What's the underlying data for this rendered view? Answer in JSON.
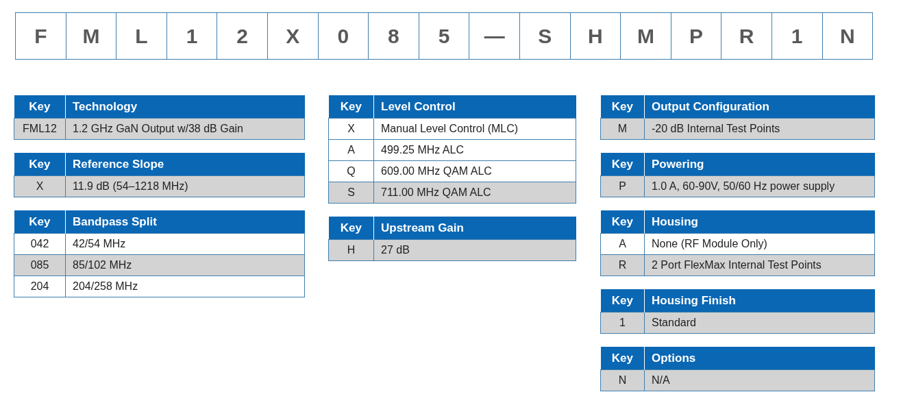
{
  "part_number": [
    "F",
    "M",
    "L",
    "1",
    "2",
    "X",
    "0",
    "8",
    "5",
    "—",
    "S",
    "H",
    "M",
    "P",
    "R",
    "1",
    "N"
  ],
  "columns": [
    [
      {
        "key_heading": "Key",
        "heading": "Technology",
        "rows": [
          {
            "key": "FML12",
            "description": "1.2 GHz GaN Output w/38 dB Gain",
            "selected": true
          }
        ]
      },
      {
        "key_heading": "Key",
        "heading": "Reference Slope",
        "rows": [
          {
            "key": "X",
            "description": "11.9 dB (54–1218 MHz)",
            "selected": true
          }
        ]
      },
      {
        "key_heading": "Key",
        "heading": "Bandpass Split",
        "rows": [
          {
            "key": "042",
            "description": "42/54 MHz",
            "selected": false
          },
          {
            "key": "085",
            "description": "85/102 MHz",
            "selected": true
          },
          {
            "key": "204",
            "description": "204/258 MHz",
            "selected": false
          }
        ]
      }
    ],
    [
      {
        "key_heading": "Key",
        "heading": "Level Control",
        "rows": [
          {
            "key": "X",
            "description": "Manual Level Control (MLC)",
            "selected": false
          },
          {
            "key": "A",
            "description": "499.25 MHz ALC",
            "selected": false
          },
          {
            "key": "Q",
            "description": "609.00 MHz QAM ALC",
            "selected": false
          },
          {
            "key": "S",
            "description": "711.00 MHz QAM ALC",
            "selected": true
          }
        ]
      },
      {
        "key_heading": "Key",
        "heading": "Upstream Gain",
        "rows": [
          {
            "key": "H",
            "description": "27 dB",
            "selected": true
          }
        ]
      }
    ],
    [
      {
        "key_heading": "Key",
        "heading": "Output Configuration",
        "rows": [
          {
            "key": "M",
            "description": "-20 dB Internal Test Points",
            "selected": true
          }
        ]
      },
      {
        "key_heading": "Key",
        "heading": "Powering",
        "rows": [
          {
            "key": "P",
            "description": "1.0 A, 60-90V, 50/60 Hz power supply",
            "selected": true
          }
        ]
      },
      {
        "key_heading": "Key",
        "heading": "Housing",
        "rows": [
          {
            "key": "A",
            "description": "None (RF Module Only)",
            "selected": false
          },
          {
            "key": "R",
            "description": "2 Port FlexMax Internal Test Points",
            "selected": true
          }
        ]
      },
      {
        "key_heading": "Key",
        "heading": "Housing Finish",
        "rows": [
          {
            "key": "1",
            "description": "Standard",
            "selected": true
          }
        ]
      },
      {
        "key_heading": "Key",
        "heading": "Options",
        "rows": [
          {
            "key": "N",
            "description": "N/A",
            "selected": true
          }
        ]
      }
    ]
  ]
}
